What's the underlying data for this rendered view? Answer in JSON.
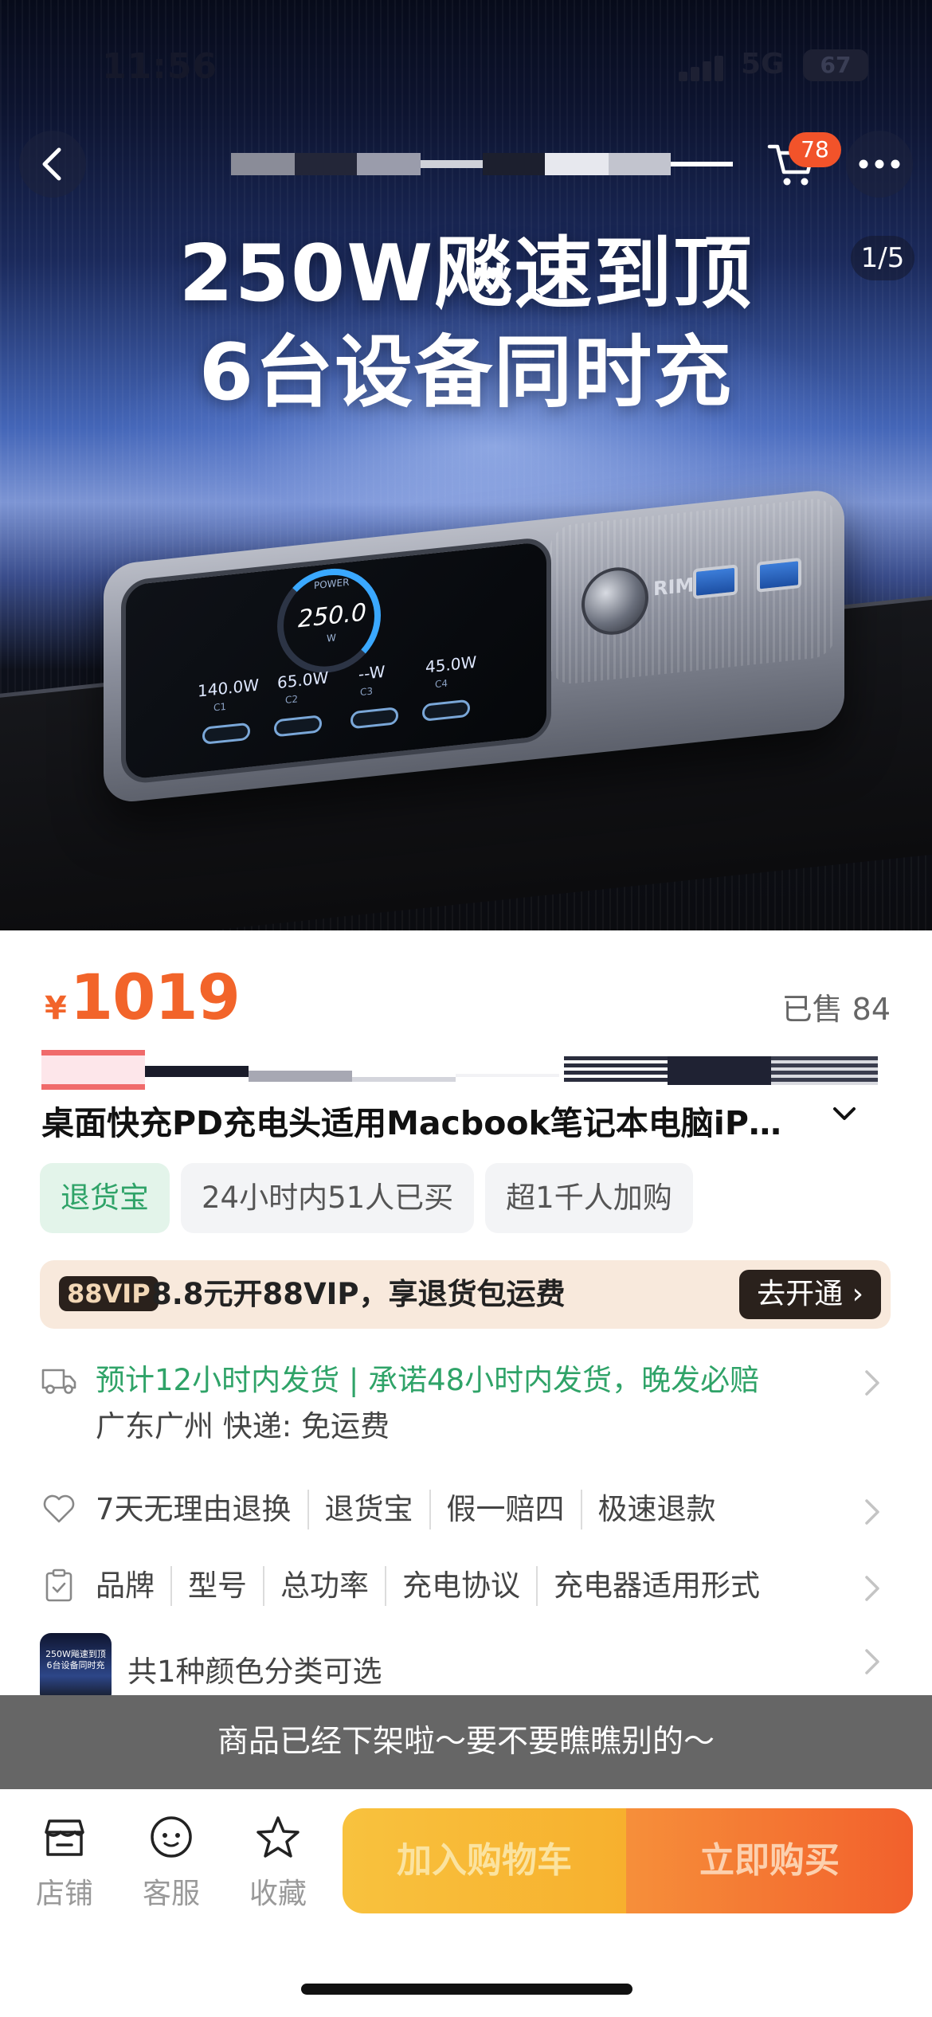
{
  "status_bar": {
    "time": "11:56",
    "network": "5G",
    "battery": "67"
  },
  "top_bar": {
    "cart_count": "78"
  },
  "hero": {
    "title_line1": "250W飚速到顶",
    "title_line2": "6台设备同时充",
    "page_indicator": "1/5",
    "device": {
      "power_label": "POWER",
      "power_value": "250.0",
      "power_unit": "W",
      "ports": [
        {
          "value": "140.0W",
          "port": "C1"
        },
        {
          "value": "65.0W",
          "port": "C2"
        },
        {
          "value": "--W",
          "port": "C3"
        },
        {
          "value": "45.0W",
          "port": "C4"
        }
      ],
      "brand_text": "RIME"
    }
  },
  "product": {
    "currency": "¥",
    "price": "1019",
    "sold_text": "已售 84",
    "title": "桌面快充PD充电头适用Macbook笔记本电脑iP…",
    "tags": [
      "退货宝",
      "24小时内51人已买",
      "超1千人加购"
    ]
  },
  "vip": {
    "logo": "88VIP",
    "text": "8.8元开88VIP，享退货包运费",
    "button": "去开通 ›"
  },
  "shipping": {
    "line1": "预计12小时内发货 | 承诺48小时内发货，晚发必赔",
    "line2": "广东广州  快递: 免运费"
  },
  "services": [
    "7天无理由退换",
    "退货宝",
    "假一赔四",
    "极速退款"
  ],
  "specs": [
    "品牌",
    "型号",
    "总功率",
    "充电协议",
    "充电器适用形式"
  ],
  "color_option": {
    "text": "共1种颜色分类可选",
    "thumb_text": "250W飚速到顶 6台设备同时充"
  },
  "toast": "商品已经下架啦～要不要瞧瞧别的～",
  "bottom_bar": {
    "shop": "店铺",
    "service": "客服",
    "favorite": "收藏",
    "add_to_cart": "加入购物车",
    "buy_now": "立即购买"
  }
}
